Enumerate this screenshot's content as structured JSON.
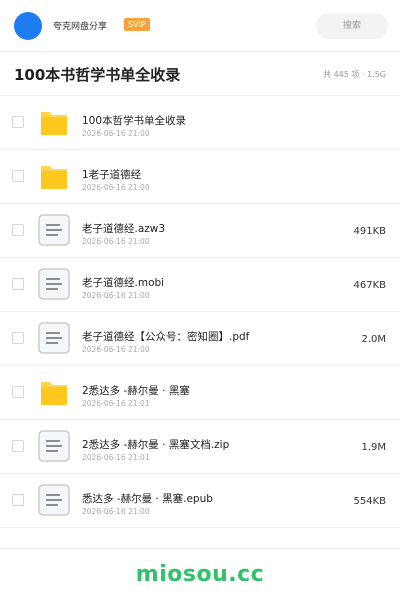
{
  "header": {
    "username": "夸克网盘分享",
    "badge": "SVIP",
    "search_label": "搜索"
  },
  "titlebar": {
    "title": "100本书哲学书单全收录",
    "summary": "共 445 项 · 1.5G"
  },
  "files": [
    {
      "type": "folder",
      "icon": "folder-icon",
      "name": "100本哲学书单全收录",
      "date": "2026-06-16 21:00",
      "size": ""
    },
    {
      "type": "folder",
      "icon": "folder-icon",
      "name": "1老子道德经",
      "date": "2026-06-16 21:00",
      "size": ""
    },
    {
      "type": "file",
      "icon": "document-icon",
      "name": "老子道德经.azw3",
      "date": "2026-06-16 21:00",
      "size": "491KB"
    },
    {
      "type": "file",
      "icon": "document-icon",
      "name": "老子道德经.mobi",
      "date": "2026-06-16 21:00",
      "size": "467KB"
    },
    {
      "type": "file",
      "icon": "document-icon",
      "name": "老子道德经【公众号：密知圈】.pdf",
      "date": "2026-06-16 21:00",
      "size": "2.0M"
    },
    {
      "type": "folder",
      "icon": "folder-icon",
      "name": "2悉达多 -赫尔曼 · 黑塞",
      "date": "2026-06-16 21:01",
      "size": ""
    },
    {
      "type": "file",
      "icon": "document-icon",
      "name": "2悉达多 -赫尔曼 · 黑塞文档.zip",
      "date": "2026-06-16 21:01",
      "size": "1.9M"
    },
    {
      "type": "file",
      "icon": "document-icon",
      "name": "悉达多 -赫尔曼 · 黑塞.epub",
      "date": "2026-06-16 21:00",
      "size": "554KB"
    }
  ],
  "footer": {
    "watermark": "miosou.cc"
  },
  "colors": {
    "avatar": "#1e7bf0",
    "badge": "#f7a23a",
    "folder": "#ffc81e",
    "watermark": "#2fc26b"
  }
}
